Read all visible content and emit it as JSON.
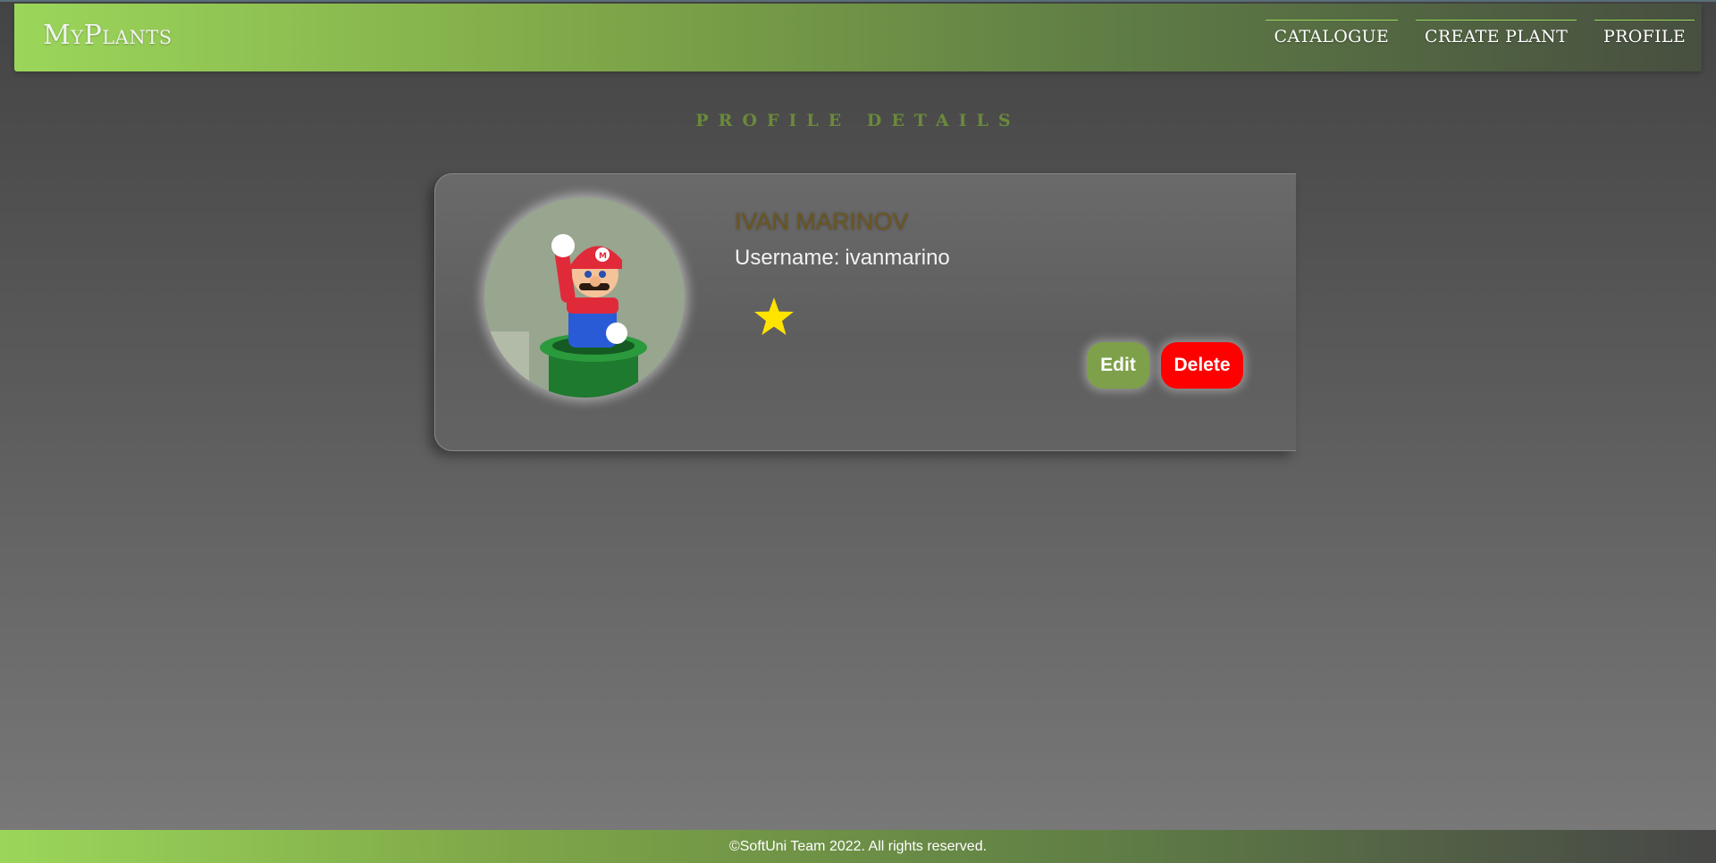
{
  "header": {
    "brand": "MyPlants",
    "nav": [
      {
        "label": "CATALOGUE"
      },
      {
        "label": "CREATE PLANT"
      },
      {
        "label": "PROFILE"
      }
    ],
    "accent_color": "#9bd65a"
  },
  "main": {
    "section_title": "PROFILE DETAILS"
  },
  "profile": {
    "full_name": "IVAN MARINOV",
    "username_label": "Username:",
    "username": "ivanmarino",
    "avatar_icon": "mario-figure-avatar",
    "badge_icon": "star-icon",
    "badge_color": "#ffe400",
    "edit_label": "Edit",
    "delete_label": "Delete",
    "edit_color": "#7ea04a",
    "delete_color": "#ff0000"
  },
  "footer": {
    "text": "©SoftUni Team 2022. All rights reserved."
  }
}
